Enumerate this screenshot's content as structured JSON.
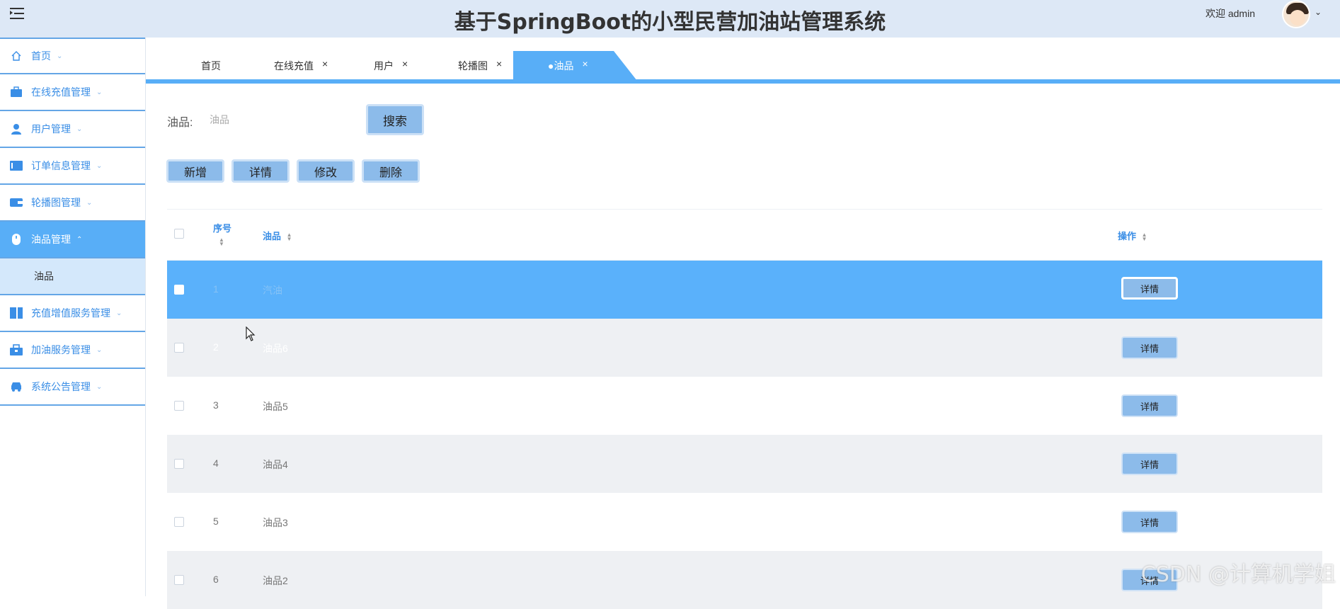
{
  "header": {
    "title": "基于SpringBoot的小型民营加油站管理系统",
    "welcome": "欢迎 admin"
  },
  "sidebar": {
    "items": [
      {
        "label": "首页",
        "icon": "home-icon"
      },
      {
        "label": "在线充值管理",
        "icon": "briefcase-icon"
      },
      {
        "label": "用户管理",
        "icon": "user-icon"
      },
      {
        "label": "订单信息管理",
        "icon": "card-icon"
      },
      {
        "label": "轮播图管理",
        "icon": "wallet-icon"
      },
      {
        "label": "油品管理",
        "icon": "mouse-icon",
        "active": true
      },
      {
        "label": "充值增值服务管理",
        "icon": "columns-icon"
      },
      {
        "label": "加油服务管理",
        "icon": "toolbox-icon"
      },
      {
        "label": "系统公告管理",
        "icon": "vehicle-icon"
      }
    ],
    "sub_item": "油品"
  },
  "tabs": [
    {
      "label": "首页"
    },
    {
      "label": "在线充值"
    },
    {
      "label": "用户"
    },
    {
      "label": "轮播图"
    },
    {
      "label": "●油品",
      "active": true
    }
  ],
  "search": {
    "label": "油品:",
    "placeholder": "油品",
    "button": "搜索"
  },
  "actions": {
    "add": "新增",
    "detail": "详情",
    "edit": "修改",
    "delete": "删除"
  },
  "table": {
    "columns": [
      "序号",
      "油品",
      "操作"
    ],
    "rows": [
      {
        "index": "1",
        "name": "汽油",
        "action": "详情"
      },
      {
        "index": "2",
        "name": "油品6",
        "action": "详情"
      },
      {
        "index": "3",
        "name": "油品5",
        "action": "详情"
      },
      {
        "index": "4",
        "name": "油品4",
        "action": "详情"
      },
      {
        "index": "5",
        "name": "油品3",
        "action": "详情"
      },
      {
        "index": "6",
        "name": "油品2",
        "action": "详情"
      }
    ]
  },
  "watermark": "CSDN @计算机学姐",
  "colors": {
    "accent": "#58aef7",
    "header_bg": "#dde8f6",
    "button_bg": "#8cbbea",
    "selected_row": "#5ab1fb"
  }
}
